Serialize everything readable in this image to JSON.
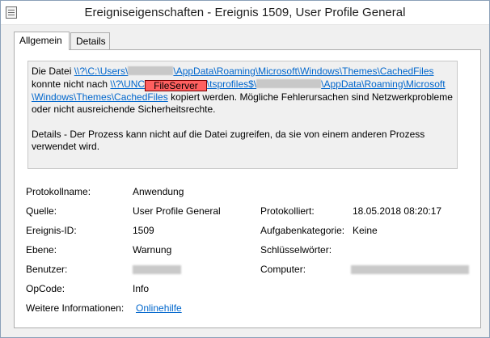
{
  "window": {
    "title": "Ereigniseigenschaften - Ereignis 1509, User Profile General"
  },
  "tabs": [
    {
      "label": "Allgemein",
      "active": true
    },
    {
      "label": "Details",
      "active": false
    }
  ],
  "message": {
    "p1_prefix": "Die Datei ",
    "p1_link1a": "\\\\?\\C:\\Users\\",
    "p1_link1b": "\\AppData\\Roaming\\Microsoft\\Windows\\Themes\\CachedFiles",
    "p1_mid": "konnte nicht nach ",
    "p1_link2a": "\\\\?\\UNC",
    "fileserver_label": "FileServer",
    "p1_link2b": "\\tsprofiles$\\",
    "p1_link2c": "\\AppData\\Roaming\\Microsoft",
    "p1_link2d": "\\Windows\\Themes\\CachedFiles",
    "p1_suffix": " kopiert werden. Mögliche Fehlerursachen sind Netzwerkprobleme oder nicht ausreichende Sicherheitsrechte.",
    "p2": " Details - Der Prozess kann nicht auf die Datei zugreifen, da sie von einem anderen Prozess verwendet wird."
  },
  "properties": {
    "protokollname_label": "Protokollname:",
    "protokollname_value": "Anwendung",
    "quelle_label": "Quelle:",
    "quelle_value": "User Profile General",
    "protokolliert_label": "Protokolliert:",
    "protokolliert_value": "18.05.2018 08:20:17",
    "ereignis_label": "Ereignis-ID:",
    "ereignis_value": "1509",
    "aufgabe_label": "Aufgabenkategorie:",
    "aufgabe_value": "Keine",
    "ebene_label": "Ebene:",
    "ebene_value": "Warnung",
    "schluessel_label": "Schlüsselwörter:",
    "benutzer_label": "Benutzer:",
    "computer_label": "Computer:",
    "opcode_label": "OpCode:",
    "opcode_value": "Info",
    "weitere_label": "Weitere Informationen:",
    "weitere_link": "Onlinehilfe"
  },
  "colors": {
    "link": "#0066cc",
    "fileserver_bg": "#ff6060"
  }
}
